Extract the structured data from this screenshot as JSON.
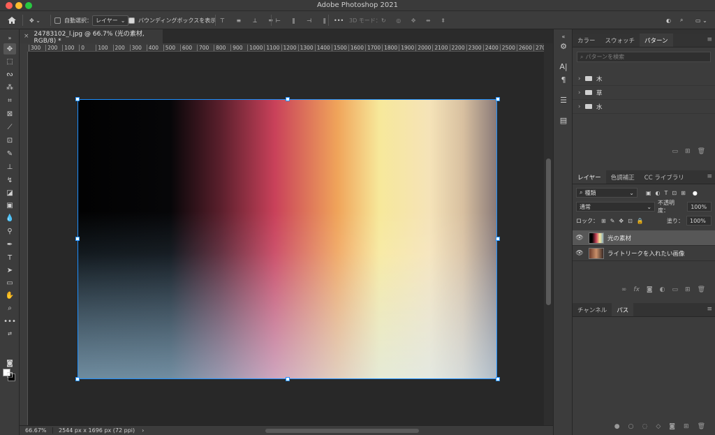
{
  "window": {
    "title": "Adobe Photoshop 2021"
  },
  "options": {
    "auto_select_label": "自動選択：",
    "auto_select_value": "レイヤー",
    "bounding_box_label": "バウンディングボックスを表示",
    "three_d_label": "3D モード："
  },
  "document": {
    "tab_title": "24783102_l.jpg @ 66.7% (光の素材, RGB/8) *",
    "close": "×"
  },
  "ruler": {
    "ticks": [
      "300",
      "200",
      "100",
      "0",
      "100",
      "200",
      "300",
      "400",
      "500",
      "600",
      "700",
      "800",
      "900",
      "1000",
      "1100",
      "1200",
      "1300",
      "1400",
      "1500",
      "1600",
      "1700",
      "1800",
      "1900",
      "2000",
      "2100",
      "2200",
      "2300",
      "2400",
      "2500",
      "2600",
      "2700",
      "2800"
    ]
  },
  "status": {
    "zoom": "66.67%",
    "info": "2544 px x 1696 px (72 ppi)",
    "arrow": "›"
  },
  "patterns_panel": {
    "tabs": [
      "カラー",
      "スウォッチ",
      "パターン"
    ],
    "search_placeholder": "パターンを検索",
    "folders": [
      "木",
      "草",
      "水"
    ]
  },
  "layers_panel": {
    "tabs": [
      "レイヤー",
      "色調補正",
      "CC ライブラリ"
    ],
    "filter_label": "種類",
    "blend_mode": "通常",
    "opacity_label": "不透明度：",
    "opacity_value": "100%",
    "lock_label": "ロック：",
    "fill_label": "塗り：",
    "fill_value": "100%",
    "layers": [
      "光の素材",
      "ライトリークを入れたい画像"
    ]
  },
  "paths_panel": {
    "tabs": [
      "チャンネル",
      "パス"
    ]
  }
}
